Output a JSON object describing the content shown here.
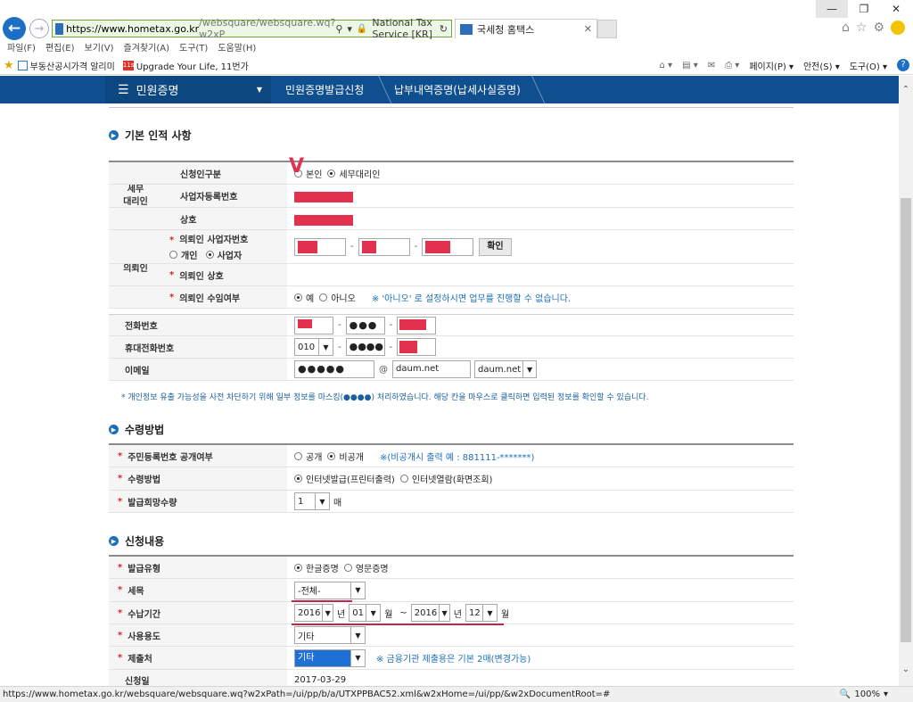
{
  "browser": {
    "url_domain": "https://www.hometax.go.kr",
    "url_rest": "/websquare/websquare.wq?w2xP",
    "site_identity": "National Tax Service [KR]",
    "tab_title": "국세청 홈택스",
    "menu": [
      "파일(F)",
      "편집(E)",
      "보기(V)",
      "즐겨찾기(A)",
      "도구(T)",
      "도움말(H)"
    ],
    "favorites": [
      "부동산공시가격 알리미",
      "Upgrade Your Life, 11번가"
    ],
    "fav2_icon_text": "11st",
    "commands": [
      "페이지(P) ▾",
      "안전(S) ▾",
      "도구(O) ▾"
    ],
    "status_url": "https://www.hometax.go.kr/websquare/websquare.wq?w2xPath=/ui/pp/b/a/UTXPPBAC52.xml&w2xHome=/ui/pp/&w2xDocumentRoot=#",
    "zoom": "100%"
  },
  "site": {
    "main_menu": "민원증명",
    "crumbs": [
      "민원증명발급신청",
      "납부내역증명(납세사실증명)"
    ]
  },
  "sections": {
    "basic": "기본 인적 사항",
    "receive": "수령방법",
    "apply": "신청내용"
  },
  "basic": {
    "group_agent": "세무\n대리인",
    "group_client": "의뢰인",
    "applicant_type_label": "신청인구분",
    "applicant_opts": [
      "본인",
      "세무대리인"
    ],
    "bizno_label": "사업자등록번호",
    "company_label": "상호",
    "client_bizno_label": "의뢰인 사업자번호",
    "client_type_opts": [
      "개인",
      "사업자"
    ],
    "confirm_btn": "확인",
    "client_name_label": "의뢰인 상호",
    "consent_label": "의뢰인 수임여부",
    "consent_opts": [
      "예",
      "아니오"
    ],
    "consent_note": "※ '아니오' 로 설정하시면 업무를 진행할 수 없습니다.",
    "phone_label": "전화번호",
    "phone_mid": "●●●",
    "mobile_label": "휴대전화번호",
    "mobile_prefix": "010",
    "mobile_mid": "●●●●",
    "email_label": "이메일",
    "email_id": "●●●●●",
    "email_at": "@",
    "email_domain": "daum.net",
    "email_select": "daum.net",
    "privacy_note": "* 개인정보 유출 가능성을 사전 차단하기 위해 일부 정보를 마스킹(●●●●) 처리하였습니다. 해당 칸을 마우스로 클릭하면 입력된 정보를 확인할 수 있습니다."
  },
  "receive": {
    "rrn_label": "주민등록번호 공개여부",
    "rrn_opts": [
      "공개",
      "비공개"
    ],
    "rrn_note": "※(비공개시 출력 예 : 881111-*******)",
    "method_label": "수령방법",
    "method_opts": [
      "인터넷발급(프린터출력)",
      "인터넷열람(화면조회)"
    ],
    "qty_label": "발급희망수량",
    "qty_value": "1",
    "qty_unit": "매"
  },
  "apply": {
    "type_label": "발급유형",
    "type_opts": [
      "한글증명",
      "영문증명"
    ],
    "tax_label": "세목",
    "tax_value": "-전체-",
    "period_label": "수납기간",
    "from_year": "2016",
    "from_month": "01",
    "to_year": "2016",
    "to_month": "12",
    "year_unit": "년",
    "month_unit": "월",
    "tilde": "~",
    "purpose_label": "사용용도",
    "purpose_value": "기타",
    "submit_label": "제출처",
    "submit_value": "기타",
    "submit_note": "※ 금융기관 제출용은 기본 2매(변경가능)",
    "date_label": "신청일",
    "date_value": "2017-03-29"
  },
  "colors": {
    "site_bar": "#0f4f8f",
    "mask_red": "#e2314e",
    "required": "#d7262a",
    "note_blue": "#1b6fb8"
  }
}
